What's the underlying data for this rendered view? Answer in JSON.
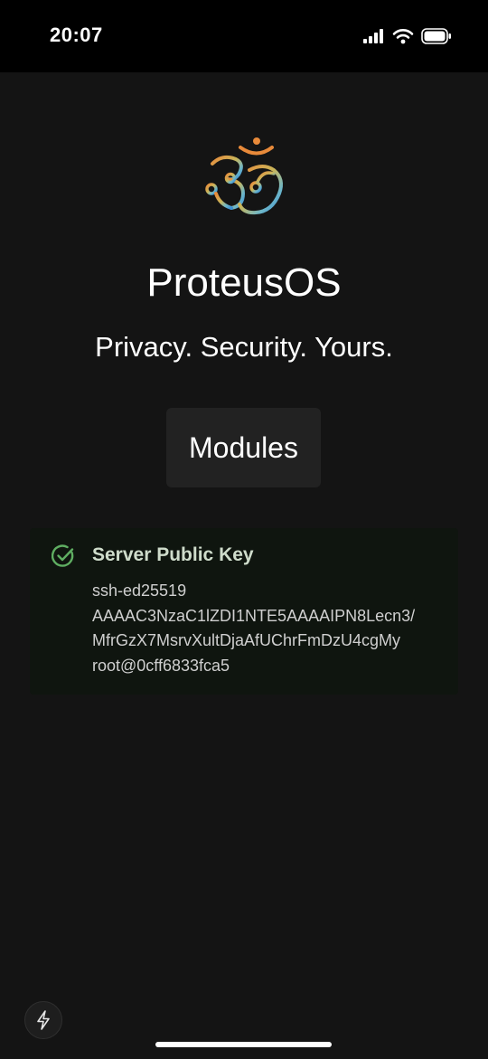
{
  "status_bar": {
    "time": "20:07",
    "icons": [
      "signal-icon",
      "wifi-icon",
      "battery-icon"
    ]
  },
  "app": {
    "logo": "om-logo",
    "title": "ProteusOS",
    "tagline": "Privacy. Security. Yours."
  },
  "modules_button": {
    "label": "Modules"
  },
  "server_key": {
    "icon": "check-circle-icon",
    "title": "Server Public Key",
    "lines": [
      "ssh-ed25519",
      "AAAAC3NzaC1lZDI1NTE5AAAAIPN8Lecn3/",
      "MfrGzX7MsrvXultDjaAfUChrFmDzU4cgMy",
      "root@0cff6833fca5"
    ]
  },
  "bottom": {
    "icon": "lightning-icon"
  },
  "colors": {
    "background": "#141414",
    "status_bar": "#000000",
    "button": "#222222",
    "card": "#0f150f",
    "success": "#5fae62"
  }
}
